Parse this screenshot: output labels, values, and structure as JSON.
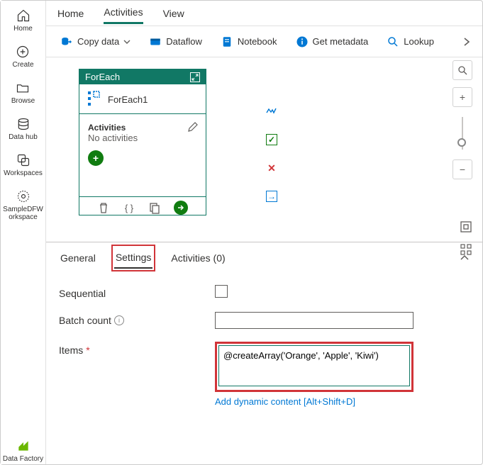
{
  "sidebar": {
    "items": [
      {
        "label": "Home"
      },
      {
        "label": "Create"
      },
      {
        "label": "Browse"
      },
      {
        "label": "Data hub"
      },
      {
        "label": "Workspaces"
      },
      {
        "label": "SampleDFW orkspace"
      }
    ],
    "bottom": {
      "label": "Data Factory"
    }
  },
  "topTabs": {
    "home": "Home",
    "activities": "Activities",
    "view": "View"
  },
  "toolbar": {
    "copyData": "Copy data",
    "dataflow": "Dataflow",
    "notebook": "Notebook",
    "getMetadata": "Get metadata",
    "lookup": "Lookup"
  },
  "node": {
    "header": "ForEach",
    "title": "ForEach1",
    "activitiesLabel": "Activities",
    "activitiesSub": "No activities"
  },
  "settings": {
    "tabs": {
      "general": "General",
      "settings": "Settings",
      "activities": "Activities (0)"
    },
    "sequential": "Sequential",
    "batchCount": "Batch count",
    "items": "Items",
    "itemsValue": "@createArray('Orange', 'Apple', 'Kiwi')",
    "addContent": "Add dynamic content [Alt+Shift+D]"
  }
}
